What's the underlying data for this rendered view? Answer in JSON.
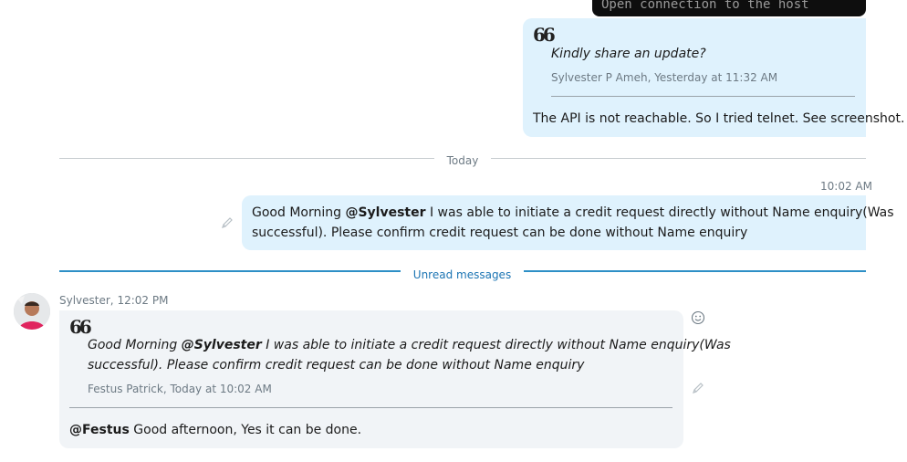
{
  "earlier_outgoing": {
    "screenshot_text": "Open connection to the host",
    "quote": {
      "text": "Kindly share an update?",
      "meta": "Sylvester P Ameh, Yesterday at 11:32 AM"
    },
    "text": "The API is not reachable. So I tried telnet. See screenshot."
  },
  "date_separator": "Today",
  "outgoing": {
    "time": "10:02 AM",
    "prefix": "Good Morning ",
    "mention": "@Sylvester",
    "line1_rest": " I was able to initiate a credit request directly without Name enquiry(Was",
    "line2": "successful). Please confirm credit request can be done without Name enquiry"
  },
  "unread_separator": "Unread messages",
  "incoming": {
    "sender_time": "Sylvester, 12:02 PM",
    "quote": {
      "prefix": "Good Morning ",
      "mention": "@Sylvester",
      "line1_rest": " I was able to initiate a credit request directly without Name enquiry(Was",
      "line2": "successful). Please confirm credit request can be done without Name enquiry",
      "meta": "Festus Patrick, Today at 10:02 AM"
    },
    "reply_mention": "@Festus",
    "reply_text": " Good afternoon, Yes it can be done."
  },
  "icons": {
    "quote": "quote-icon",
    "edit": "pencil-icon",
    "react": "smiley-icon"
  },
  "colors": {
    "outgoing_bubble": "#dff2fd",
    "incoming_bubble": "#f1f4f7",
    "unread_accent": "#2d8fc6"
  }
}
